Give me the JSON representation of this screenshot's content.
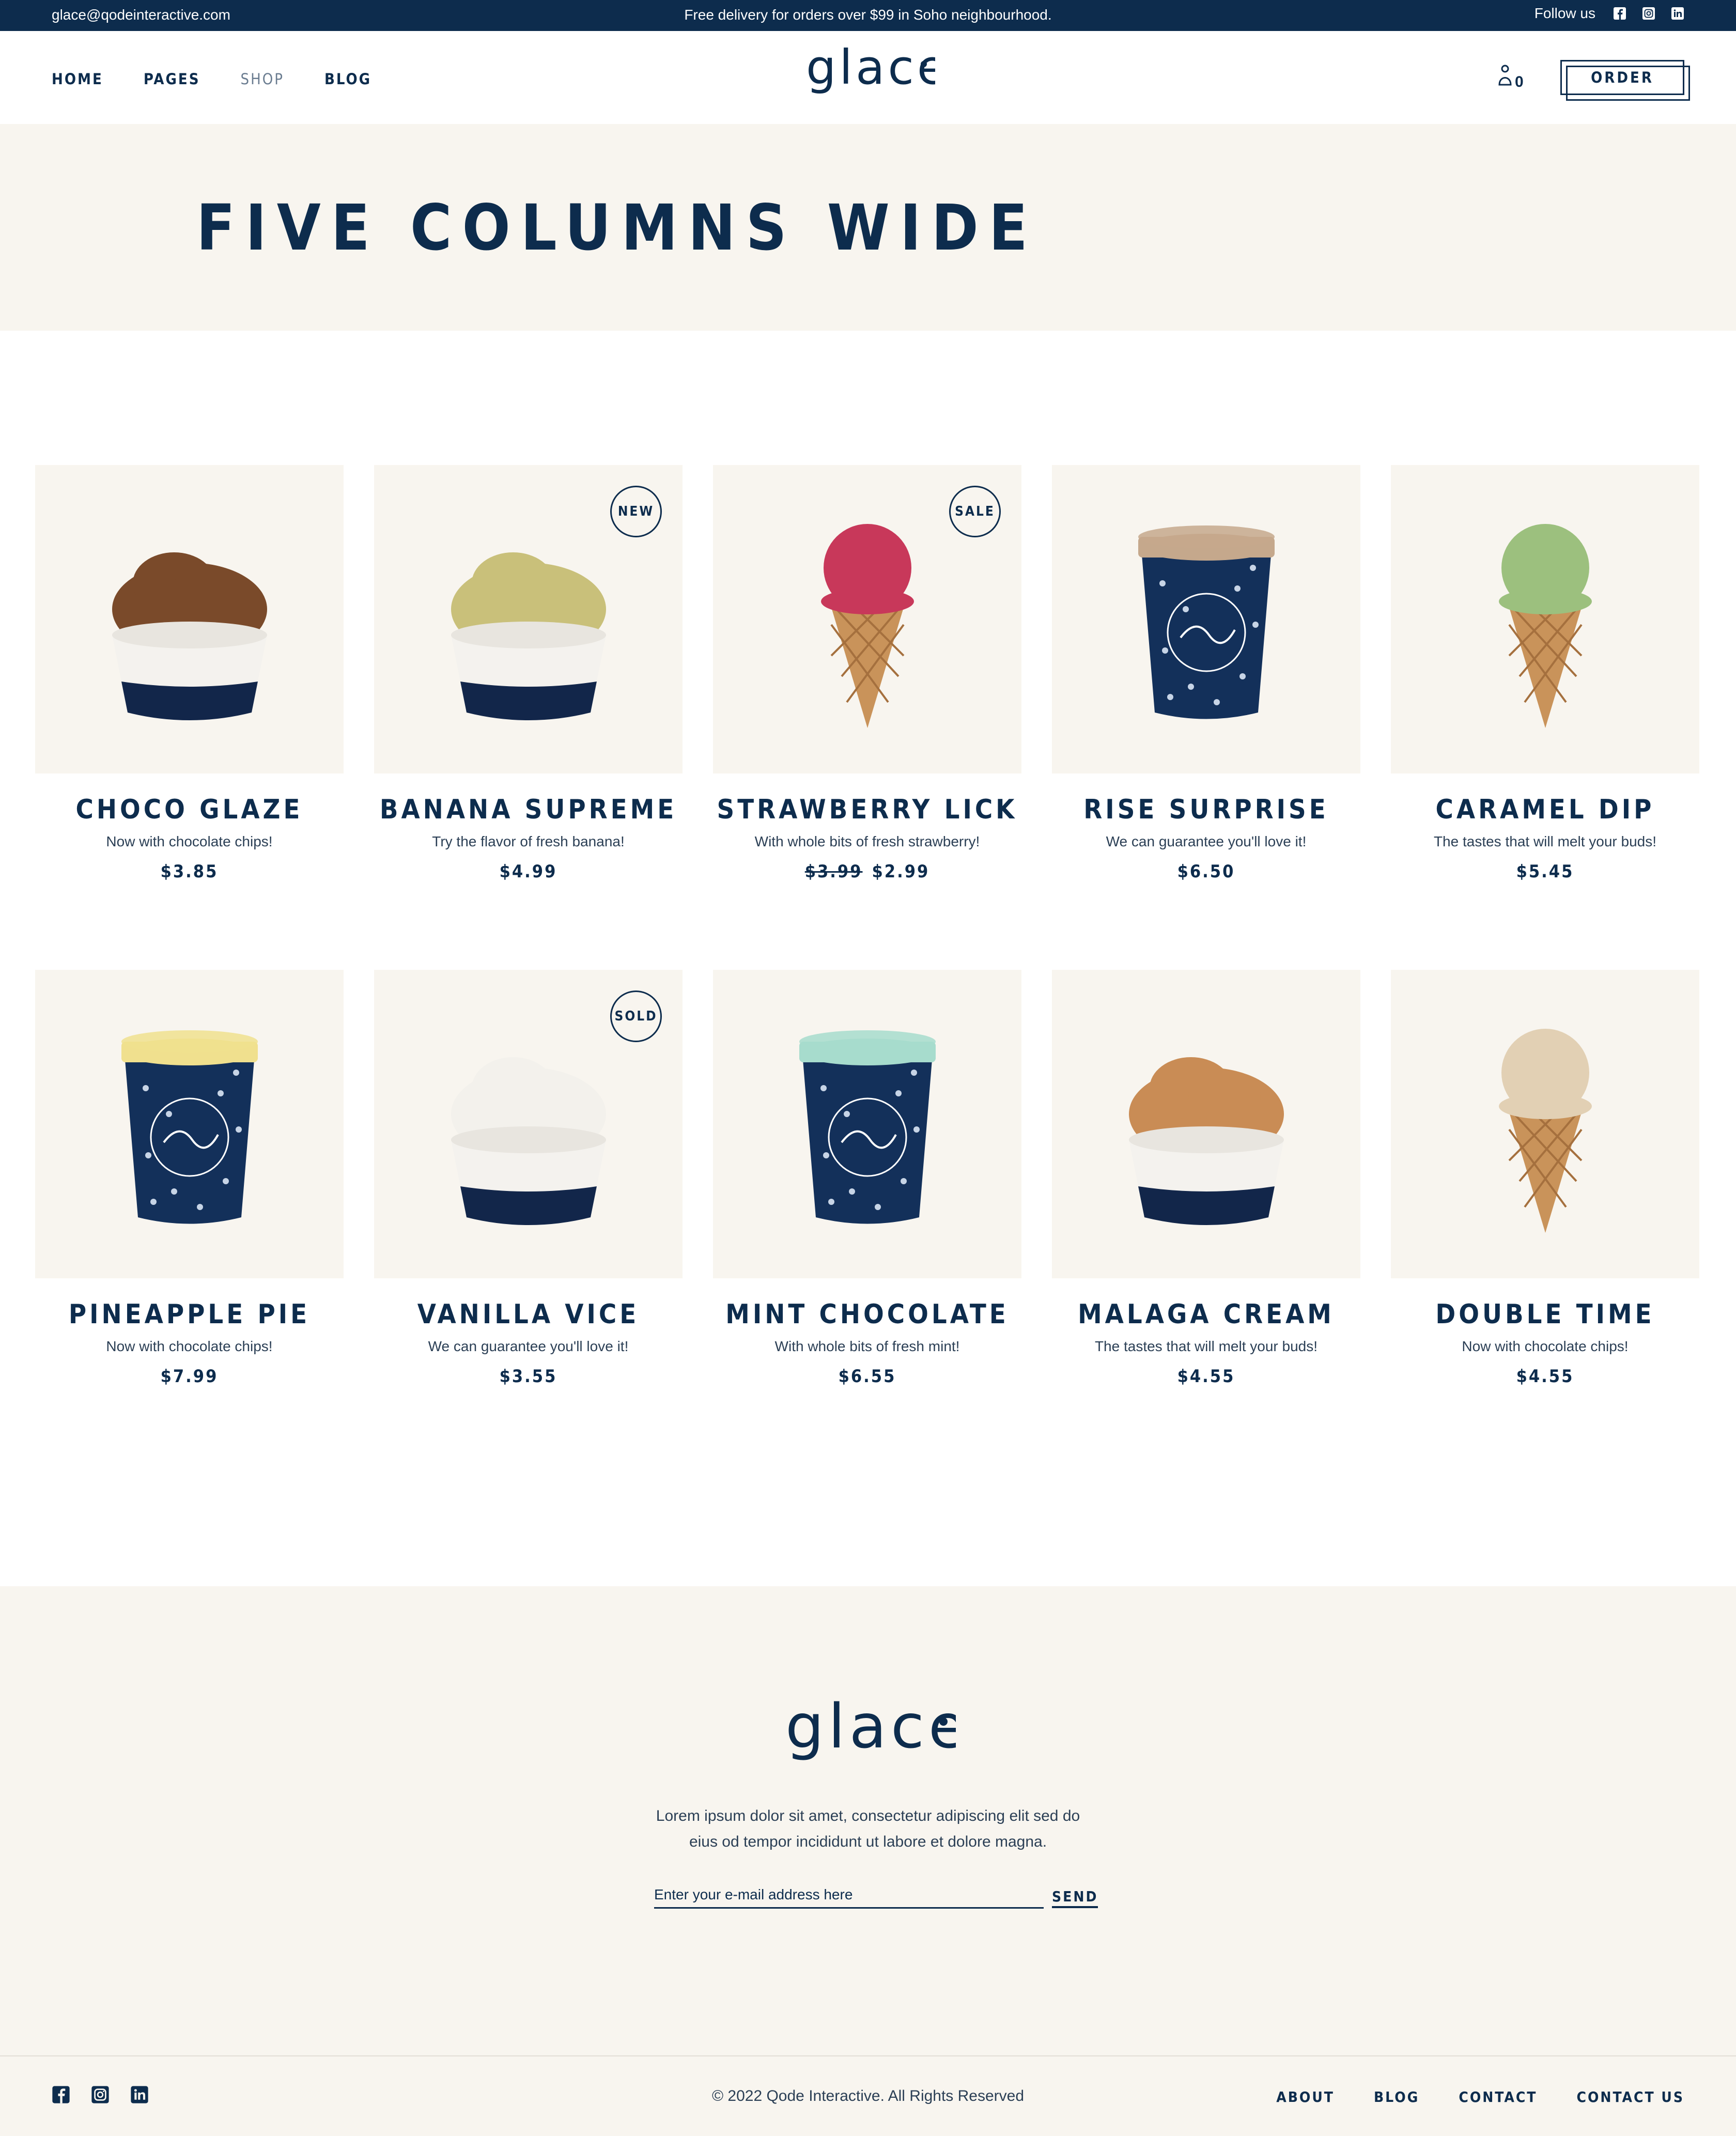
{
  "topbar": {
    "email": "glace@qodeinteractive.com",
    "promo": "Free delivery for orders over $99 in Soho neighbourhood.",
    "follow_label": "Follow us",
    "social_icons": [
      "facebook-icon",
      "instagram-icon",
      "linkedin-icon"
    ]
  },
  "header": {
    "nav": [
      "HOME",
      "PAGES",
      "SHOP",
      "BLOG"
    ],
    "logo_text": "glace",
    "cart_count": "0",
    "order_label": "ORDER"
  },
  "hero": {
    "title": "FIVE COLUMNS WIDE"
  },
  "products": [
    {
      "name": "CHOCO GLAZE",
      "desc": "Now with chocolate chips!",
      "price": "$3.85",
      "old_price": "",
      "badge": "",
      "kind": "cup",
      "color": "#7a4a2a"
    },
    {
      "name": "BANANA SUPREME",
      "desc": "Try the flavor of fresh banana!",
      "price": "$4.99",
      "old_price": "",
      "badge": "NEW",
      "kind": "cup",
      "color": "#c9c07a"
    },
    {
      "name": "STRAWBERRY LICK",
      "desc": "With whole bits of fresh strawberry!",
      "price": "$2.99",
      "old_price": "$3.99",
      "badge": "SALE",
      "kind": "cone",
      "color": "#c8385a"
    },
    {
      "name": "RISE SURPRISE",
      "desc": "We can guarantee you'll love it!",
      "price": "$6.50",
      "old_price": "",
      "badge": "",
      "kind": "tub",
      "color": "#c5a88c"
    },
    {
      "name": "CARAMEL DIP",
      "desc": "The tastes that will melt your buds!",
      "price": "$5.45",
      "old_price": "",
      "badge": "",
      "kind": "cone",
      "color": "#9cc07e"
    },
    {
      "name": "PINEAPPLE PIE",
      "desc": "Now with chocolate chips!",
      "price": "$7.99",
      "old_price": "",
      "badge": "",
      "kind": "tub",
      "color": "#f0e08e"
    },
    {
      "name": "VANILLA VICE",
      "desc": "We can guarantee you'll love it!",
      "price": "$3.55",
      "old_price": "",
      "badge": "SOLD",
      "kind": "cup",
      "color": "#f3f1ec"
    },
    {
      "name": "MINT CHOCOLATE",
      "desc": "With whole bits of fresh mint!",
      "price": "$6.55",
      "old_price": "",
      "badge": "",
      "kind": "tub",
      "color": "#a7dccd"
    },
    {
      "name": "MALAGA CREAM",
      "desc": "The tastes that will melt your buds!",
      "price": "$4.55",
      "old_price": "",
      "badge": "",
      "kind": "cup",
      "color": "#c98c55"
    },
    {
      "name": "DOUBLE TIME",
      "desc": "Now with chocolate chips!",
      "price": "$4.55",
      "old_price": "",
      "badge": "",
      "kind": "cone",
      "color": "#e2d0b4"
    }
  ],
  "footer": {
    "logo_text": "glace",
    "text_line1": "Lorem ipsum dolor sit amet, consectetur adipiscing elit sed do",
    "text_line2": "eius od tempor incididunt ut labore et dolore magna.",
    "email_placeholder": "Enter your e-mail address here",
    "send_label": "SEND",
    "copyright": "© 2022 Qode Interactive. All Rights Reserved",
    "links": [
      "ABOUT",
      "BLOG",
      "CONTACT",
      "CONTACT US"
    ]
  },
  "colors": {
    "navy": "#0d2c4d",
    "cream": "#f8f5ef"
  }
}
